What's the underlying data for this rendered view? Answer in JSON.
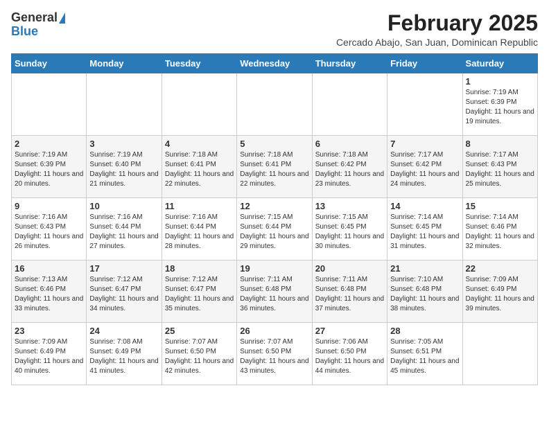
{
  "logo": {
    "general": "General",
    "blue": "Blue",
    "arrow": "▶"
  },
  "title": "February 2025",
  "subtitle": "Cercado Abajo, San Juan, Dominican Republic",
  "days_of_week": [
    "Sunday",
    "Monday",
    "Tuesday",
    "Wednesday",
    "Thursday",
    "Friday",
    "Saturday"
  ],
  "weeks": [
    [
      {
        "day": "",
        "info": ""
      },
      {
        "day": "",
        "info": ""
      },
      {
        "day": "",
        "info": ""
      },
      {
        "day": "",
        "info": ""
      },
      {
        "day": "",
        "info": ""
      },
      {
        "day": "",
        "info": ""
      },
      {
        "day": "1",
        "info": "Sunrise: 7:19 AM\nSunset: 6:39 PM\nDaylight: 11 hours and 19 minutes."
      }
    ],
    [
      {
        "day": "2",
        "info": "Sunrise: 7:19 AM\nSunset: 6:39 PM\nDaylight: 11 hours and 20 minutes."
      },
      {
        "day": "3",
        "info": "Sunrise: 7:19 AM\nSunset: 6:40 PM\nDaylight: 11 hours and 21 minutes."
      },
      {
        "day": "4",
        "info": "Sunrise: 7:18 AM\nSunset: 6:41 PM\nDaylight: 11 hours and 22 minutes."
      },
      {
        "day": "5",
        "info": "Sunrise: 7:18 AM\nSunset: 6:41 PM\nDaylight: 11 hours and 22 minutes."
      },
      {
        "day": "6",
        "info": "Sunrise: 7:18 AM\nSunset: 6:42 PM\nDaylight: 11 hours and 23 minutes."
      },
      {
        "day": "7",
        "info": "Sunrise: 7:17 AM\nSunset: 6:42 PM\nDaylight: 11 hours and 24 minutes."
      },
      {
        "day": "8",
        "info": "Sunrise: 7:17 AM\nSunset: 6:43 PM\nDaylight: 11 hours and 25 minutes."
      }
    ],
    [
      {
        "day": "9",
        "info": "Sunrise: 7:16 AM\nSunset: 6:43 PM\nDaylight: 11 hours and 26 minutes."
      },
      {
        "day": "10",
        "info": "Sunrise: 7:16 AM\nSunset: 6:44 PM\nDaylight: 11 hours and 27 minutes."
      },
      {
        "day": "11",
        "info": "Sunrise: 7:16 AM\nSunset: 6:44 PM\nDaylight: 11 hours and 28 minutes."
      },
      {
        "day": "12",
        "info": "Sunrise: 7:15 AM\nSunset: 6:44 PM\nDaylight: 11 hours and 29 minutes."
      },
      {
        "day": "13",
        "info": "Sunrise: 7:15 AM\nSunset: 6:45 PM\nDaylight: 11 hours and 30 minutes."
      },
      {
        "day": "14",
        "info": "Sunrise: 7:14 AM\nSunset: 6:45 PM\nDaylight: 11 hours and 31 minutes."
      },
      {
        "day": "15",
        "info": "Sunrise: 7:14 AM\nSunset: 6:46 PM\nDaylight: 11 hours and 32 minutes."
      }
    ],
    [
      {
        "day": "16",
        "info": "Sunrise: 7:13 AM\nSunset: 6:46 PM\nDaylight: 11 hours and 33 minutes."
      },
      {
        "day": "17",
        "info": "Sunrise: 7:12 AM\nSunset: 6:47 PM\nDaylight: 11 hours and 34 minutes."
      },
      {
        "day": "18",
        "info": "Sunrise: 7:12 AM\nSunset: 6:47 PM\nDaylight: 11 hours and 35 minutes."
      },
      {
        "day": "19",
        "info": "Sunrise: 7:11 AM\nSunset: 6:48 PM\nDaylight: 11 hours and 36 minutes."
      },
      {
        "day": "20",
        "info": "Sunrise: 7:11 AM\nSunset: 6:48 PM\nDaylight: 11 hours and 37 minutes."
      },
      {
        "day": "21",
        "info": "Sunrise: 7:10 AM\nSunset: 6:48 PM\nDaylight: 11 hours and 38 minutes."
      },
      {
        "day": "22",
        "info": "Sunrise: 7:09 AM\nSunset: 6:49 PM\nDaylight: 11 hours and 39 minutes."
      }
    ],
    [
      {
        "day": "23",
        "info": "Sunrise: 7:09 AM\nSunset: 6:49 PM\nDaylight: 11 hours and 40 minutes."
      },
      {
        "day": "24",
        "info": "Sunrise: 7:08 AM\nSunset: 6:49 PM\nDaylight: 11 hours and 41 minutes."
      },
      {
        "day": "25",
        "info": "Sunrise: 7:07 AM\nSunset: 6:50 PM\nDaylight: 11 hours and 42 minutes."
      },
      {
        "day": "26",
        "info": "Sunrise: 7:07 AM\nSunset: 6:50 PM\nDaylight: 11 hours and 43 minutes."
      },
      {
        "day": "27",
        "info": "Sunrise: 7:06 AM\nSunset: 6:50 PM\nDaylight: 11 hours and 44 minutes."
      },
      {
        "day": "28",
        "info": "Sunrise: 7:05 AM\nSunset: 6:51 PM\nDaylight: 11 hours and 45 minutes."
      },
      {
        "day": "",
        "info": ""
      }
    ]
  ]
}
